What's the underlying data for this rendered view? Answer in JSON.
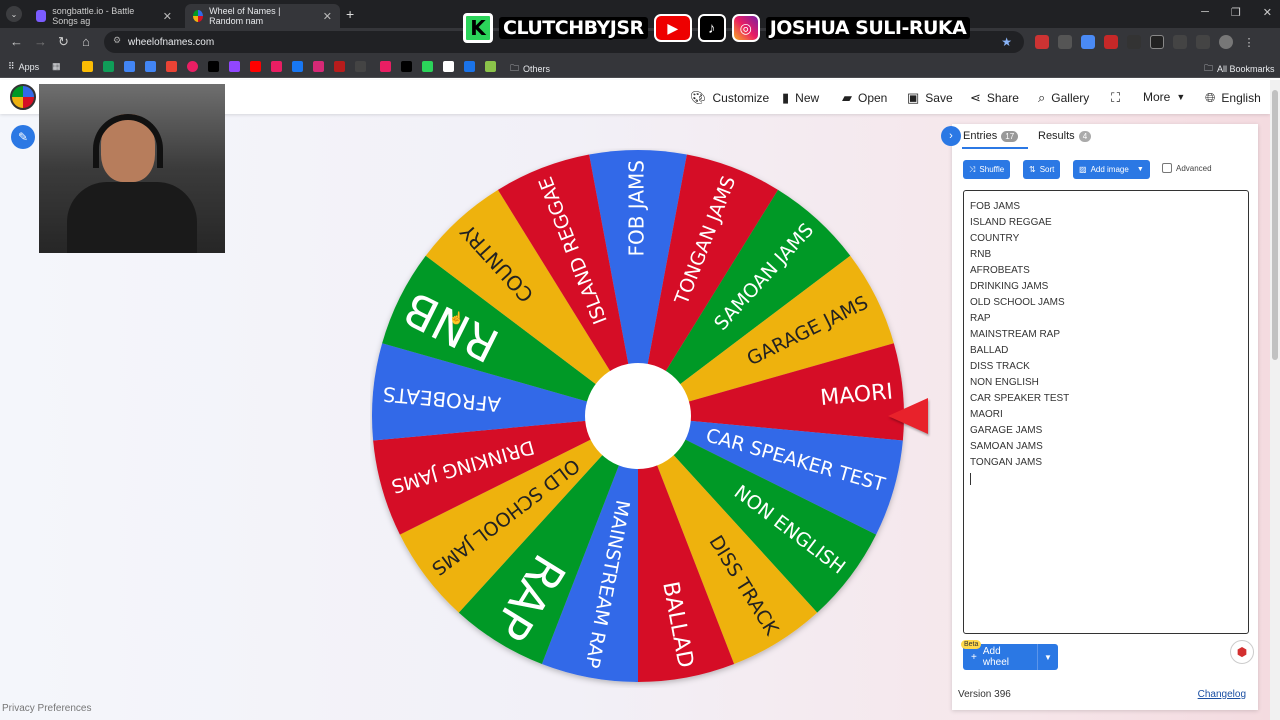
{
  "browser": {
    "tabs": [
      {
        "title": "songbattle.io - Battle Songs ag",
        "active": false
      },
      {
        "title": "Wheel of Names | Random nam",
        "active": true
      }
    ],
    "url": "wheelofnames.com",
    "bookmarks": {
      "apps_label": "Apps",
      "others_label": "Others",
      "all_bookmarks_label": "All Bookmarks"
    }
  },
  "overlay": {
    "brand": "CLUTCHBYJSR",
    "handle": "JOSHUA SULI-RUKA"
  },
  "header": {
    "menu": [
      "Customize",
      "New",
      "Open",
      "Save",
      "Share",
      "Gallery",
      "More",
      "English"
    ]
  },
  "wheel": {
    "segments": [
      {
        "label": "FOB JAMS",
        "color": "#3369e8"
      },
      {
        "label": "TONGAN JAMS",
        "color": "#d50f25"
      },
      {
        "label": "SAMOAN JAMS",
        "color": "#009925"
      },
      {
        "label": "GARAGE JAMS",
        "color": "#eeb211"
      },
      {
        "label": "MAORI",
        "color": "#d50f25"
      },
      {
        "label": "CAR SPEAKER TEST",
        "color": "#3369e8"
      },
      {
        "label": "NON ENGLISH",
        "color": "#009925"
      },
      {
        "label": "DISS TRACK",
        "color": "#eeb211"
      },
      {
        "label": "BALLAD",
        "color": "#d50f25"
      },
      {
        "label": "MAINSTREAM RAP",
        "color": "#3369e8"
      },
      {
        "label": "RAP",
        "color": "#009925"
      },
      {
        "label": "OLD SCHOOL JAMS",
        "color": "#eeb211"
      },
      {
        "label": "DRINKING JAMS",
        "color": "#d50f25"
      },
      {
        "label": "AFROBEATS",
        "color": "#3369e8"
      },
      {
        "label": "RNB",
        "color": "#009925"
      },
      {
        "label": "COUNTRY",
        "color": "#eeb211"
      },
      {
        "label": "ISLAND REGGAE",
        "color": "#d50f25"
      }
    ]
  },
  "panel": {
    "tab_entries": "Entries",
    "entries_count": "17",
    "tab_results": "Results",
    "results_count": "4",
    "shuffle_label": "Shuffle",
    "sort_label": "Sort",
    "add_image_label": "Add image",
    "advanced_label": "Advanced",
    "entries": [
      "FOB JAMS",
      "ISLAND REGGAE",
      "COUNTRY",
      "RNB",
      "AFROBEATS",
      "DRINKING JAMS",
      "OLD SCHOOL JAMS",
      "RAP",
      "MAINSTREAM RAP",
      "BALLAD",
      "DISS TRACK",
      "NON ENGLISH",
      "CAR SPEAKER TEST",
      "MAORI",
      "GARAGE JAMS",
      "SAMOAN JAMS",
      "TONGAN JAMS"
    ],
    "beta_label": "Beta",
    "add_wheel_label": "Add wheel",
    "version": "Version 396",
    "changelog": "Changelog"
  },
  "footer": {
    "privacy": "Privacy Preferences"
  }
}
